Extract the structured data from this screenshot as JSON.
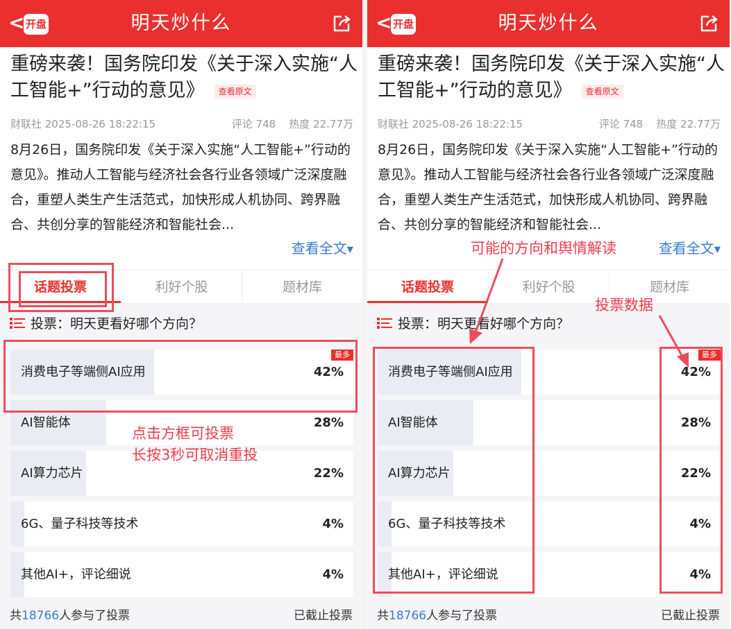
{
  "header": {
    "title": "明天炒什么",
    "back_glyph": "<",
    "logo_text": "开盘"
  },
  "article": {
    "title": "重磅来袭！国务院印发《关于深入实施“人工智能+”行动的意见》",
    "view_original": "查看原文",
    "source_time": "财联社 2025-08-26 18:22:15",
    "comments": "评论 748",
    "heat": "热度 22.77万",
    "summary": "8月26日，国务院印发《关于深入实施“人工智能+”行动的意见》。推动人工智能与经济社会各行业各领域广泛深度融合，重塑人类生产生活范式，加快形成人机协同、跨界融合、共创分享的智能经济和智能社会...",
    "read_more": "查看全文"
  },
  "tabs": [
    "话题投票",
    "利好个股",
    "题材库"
  ],
  "vote": {
    "question": "投票：明天更看好哪个方向？",
    "options": [
      {
        "label": "消费电子等端侧AI应用",
        "percent": "42%",
        "value": 0.42,
        "badge": "最多"
      },
      {
        "label": "AI智能体",
        "percent": "28%",
        "value": 0.28
      },
      {
        "label": "AI算力芯片",
        "percent": "22%",
        "value": 0.22
      },
      {
        "label": "6G、量子科技等技术",
        "percent": "4%",
        "value": 0.04
      },
      {
        "label": "其他AI+，评论细说",
        "percent": "4%",
        "value": 0.04
      }
    ],
    "participants_prefix": "共",
    "participants_count": "18766",
    "participants_suffix": "人参与了投票",
    "closed": "已截止投票"
  },
  "annotations": {
    "tap_to_vote": "点击方框可投票",
    "long_press": "长按3秒可取消重投",
    "direction_note": "可能的方向和舆情解读",
    "vote_data_note": "投票数据"
  },
  "colors": {
    "brand_red": "#e9302f",
    "annotation_red": "#ed4c5c",
    "link_blue": "#3a7bd5",
    "fill_gray": "#e9edf3"
  }
}
